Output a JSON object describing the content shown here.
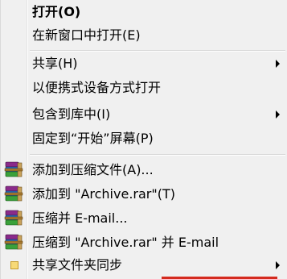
{
  "menu": {
    "items": [
      {
        "label": "打开(O)"
      },
      {
        "label": "在新窗口中打开(E)"
      },
      {
        "label": "共享(H)"
      },
      {
        "label": "以便携式设备方式打开"
      },
      {
        "label": "包含到库中(I)"
      },
      {
        "label": "固定到“开始”屏幕(P)"
      },
      {
        "label": "添加到压缩文件(A)..."
      },
      {
        "label": "添加到 \"Archive.rar\"(T)"
      },
      {
        "label": "压缩并 E-mail..."
      },
      {
        "label": "压缩到 \"Archive.rar\" 并 E-mail"
      },
      {
        "label": "共享文件夹同步"
      }
    ],
    "icons": [
      "winrar-icon",
      "winrar-icon",
      "winrar-icon",
      "winrar-icon",
      "folder-sync-icon"
    ],
    "colors": {
      "background": "#f0f0f0",
      "separator": "#d7d7d7",
      "bottom_accent": "#d42a1e"
    }
  }
}
